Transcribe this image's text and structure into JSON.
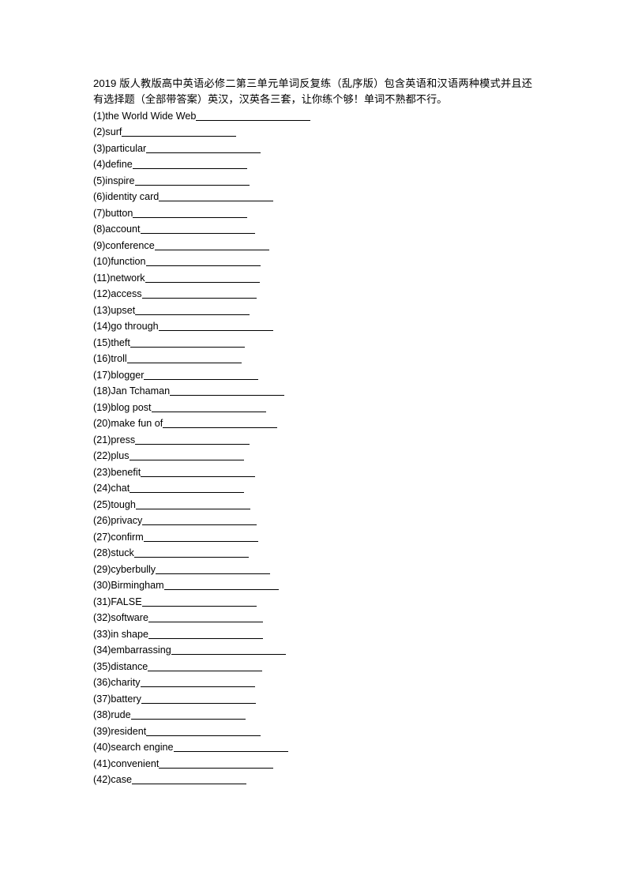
{
  "document": {
    "intro_line_1": "2019 版人教版高中英语必修二第三单元单词反复练（乱序版）包含英语和汉语两种模式并",
    "intro_line_2": "且还有选择题（全部带答案）英汉，汉英各三套，让你练个够！单词不熟都不行。",
    "intro_full": "2019 版人教版高中英语必修二第三单元单词反复练（乱序版）包含英语和汉语两种模式并且还有选择题（全部带答案）英汉，汉英各三套，让你练个够！单词不熟都不行。"
  },
  "items": [
    {
      "number": "(1)",
      "term": "the World Wide Web"
    },
    {
      "number": "(2)",
      "term": "surf"
    },
    {
      "number": "(3)",
      "term": "particular"
    },
    {
      "number": "(4)",
      "term": "define"
    },
    {
      "number": "(5)",
      "term": "inspire"
    },
    {
      "number": "(6)",
      "term": "identity card"
    },
    {
      "number": "(7)",
      "term": "button"
    },
    {
      "number": "(8)",
      "term": "account"
    },
    {
      "number": "(9)",
      "term": "conference"
    },
    {
      "number": "(10)",
      "term": "function"
    },
    {
      "number": "(11)",
      "term": "network"
    },
    {
      "number": "(12)",
      "term": "access"
    },
    {
      "number": "(13)",
      "term": "upset"
    },
    {
      "number": "(14)",
      "term": "go through"
    },
    {
      "number": "(15)",
      "term": "theft"
    },
    {
      "number": "(16)",
      "term": "troll"
    },
    {
      "number": "(17)",
      "term": "blogger"
    },
    {
      "number": "(18)",
      "term": "Jan Tchaman"
    },
    {
      "number": "(19)",
      "term": "blog post"
    },
    {
      "number": "(20)",
      "term": "make fun of"
    },
    {
      "number": "(21)",
      "term": "press"
    },
    {
      "number": "(22)",
      "term": "plus"
    },
    {
      "number": "(23)",
      "term": "benefit"
    },
    {
      "number": "(24)",
      "term": "chat"
    },
    {
      "number": "(25)",
      "term": "tough"
    },
    {
      "number": "(26)",
      "term": "privacy"
    },
    {
      "number": "(27)",
      "term": "confirm"
    },
    {
      "number": "(28)",
      "term": "stuck"
    },
    {
      "number": "(29)",
      "term": "cyberbully"
    },
    {
      "number": "(30)",
      "term": "Birmingham"
    },
    {
      "number": "(31)",
      "term": "FALSE"
    },
    {
      "number": "(32)",
      "term": "software"
    },
    {
      "number": "(33)",
      "term": "in shape"
    },
    {
      "number": "(34)",
      "term": "embarrassing"
    },
    {
      "number": "(35)",
      "term": "distance"
    },
    {
      "number": "(36)",
      "term": "charity"
    },
    {
      "number": "(37)",
      "term": "battery"
    },
    {
      "number": "(38)",
      "term": "rude"
    },
    {
      "number": "(39)",
      "term": "resident"
    },
    {
      "number": "(40)",
      "term": "search engine"
    },
    {
      "number": "(41)",
      "term": "convenient"
    },
    {
      "number": "(42)",
      "term": "case"
    }
  ]
}
